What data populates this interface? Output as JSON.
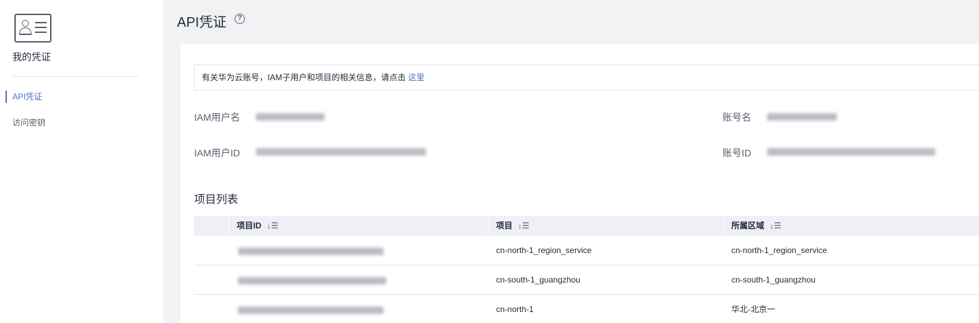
{
  "sidebar": {
    "title": "我的凭证",
    "items": [
      {
        "label": "API凭证",
        "active": true
      },
      {
        "label": "访问密钥",
        "active": false
      }
    ]
  },
  "header": {
    "title": "API凭证",
    "help_icon": "question-circle-icon"
  },
  "info": {
    "text": "有关华为云账号，IAM子用户和项目的相关信息，请点击",
    "link": "这里"
  },
  "fields": {
    "iam_user_name_label": "IAM用户名",
    "iam_user_id_label": "IAM用户ID",
    "account_name_label": "账号名",
    "account_id_label": "账号ID"
  },
  "projects": {
    "title": "项目列表",
    "columns": [
      "项目ID",
      "项目",
      "所属区域"
    ],
    "sort_icon": "sort-descending-icon",
    "rows": [
      {
        "project": "cn-north-1_region_service",
        "region": "cn-north-1_region_service"
      },
      {
        "project": "cn-south-1_guangzhou",
        "region": "cn-south-1_guangzhou"
      },
      {
        "project": "cn-north-1",
        "region": "华北-北京一"
      }
    ]
  },
  "colors": {
    "accent": "#526ecc",
    "text": "#252b3a",
    "muted": "#575d6c",
    "background": "#f1f2f4",
    "table_header": "#eef0f5"
  }
}
